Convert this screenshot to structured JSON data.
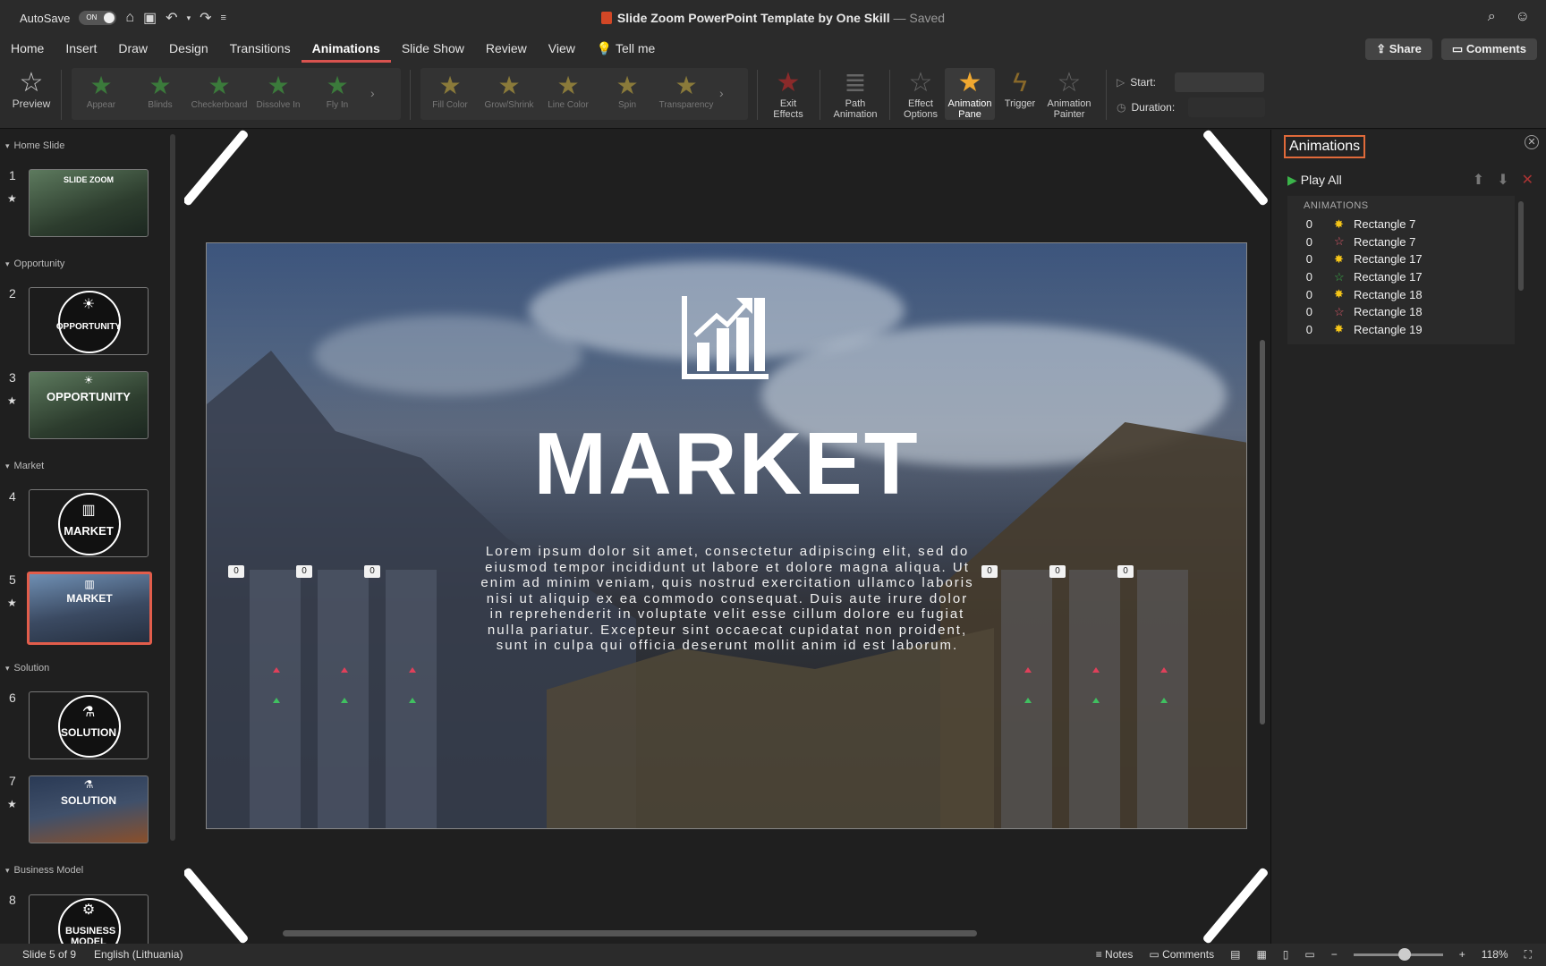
{
  "titlebar": {
    "autosave_label": "AutoSave",
    "autosave_state": "ON",
    "doc_title": "Slide Zoom PowerPoint Template by One Skill",
    "saved_status": "— Saved"
  },
  "menu": {
    "tabs": [
      "Home",
      "Insert",
      "Draw",
      "Design",
      "Transitions",
      "Animations",
      "Slide Show",
      "Review",
      "View"
    ],
    "tell_me": "Tell me",
    "share": "Share",
    "comments": "Comments"
  },
  "ribbon": {
    "preview": "Preview",
    "entrance_effects": [
      "Appear",
      "Blinds",
      "Checkerboard",
      "Dissolve In",
      "Fly In"
    ],
    "emphasis_effects": [
      "Fill Color",
      "Grow/Shrink",
      "Line Color",
      "Spin",
      "Transparency"
    ],
    "exit_effects_l1": "Exit",
    "exit_effects_l2": "Effects",
    "path_animation_l1": "Path",
    "path_animation_l2": "Animation",
    "effect_options_l1": "Effect",
    "effect_options_l2": "Options",
    "animation_pane_l1": "Animation",
    "animation_pane_l2": "Pane",
    "trigger": "Trigger",
    "animation_painter_l1": "Animation",
    "animation_painter_l2": "Painter",
    "start_label": "Start:",
    "duration_label": "Duration:"
  },
  "thumbnails": {
    "sections": [
      "Home Slide",
      "Opportunity",
      "Market",
      "Solution",
      "Business Model"
    ],
    "slides": [
      {
        "num": "1",
        "label": "SLIDE ZOOM"
      },
      {
        "num": "2",
        "label": "OPPORTUNITY"
      },
      {
        "num": "3",
        "label": "OPPORTUNITY"
      },
      {
        "num": "4",
        "label": "MARKET"
      },
      {
        "num": "5",
        "label": "MARKET"
      },
      {
        "num": "6",
        "label": "SOLUTION"
      },
      {
        "num": "7",
        "label": "SOLUTION"
      },
      {
        "num": "8",
        "label": "BUSINESS MODEL"
      }
    ]
  },
  "slide": {
    "title": "MARKET",
    "body": "Lorem ipsum dolor sit amet, consectetur adipiscing elit, sed do eiusmod tempor incididunt ut labore et dolore magna aliqua. Ut enim ad minim veniam, quis nostrud exercitation ullamco laboris nisi ut aliquip ex ea commodo consequat. Duis aute irure dolor in reprehenderit in voluptate velit esse cillum dolore eu fugiat nulla pariatur. Excepteur sint occaecat cupidatat non proident, sunt in culpa qui officia deserunt mollit anim id est laborum.",
    "tags": [
      "0",
      "0",
      "0",
      "0",
      "0",
      "0"
    ]
  },
  "animation_pane": {
    "title": "Animations",
    "play_all": "Play All",
    "list_header": "ANIMATIONS",
    "items": [
      {
        "order": "0",
        "name": "Rectangle 7",
        "effect_color": "#f5c518"
      },
      {
        "order": "0",
        "name": "Rectangle 7",
        "effect_color": "#e05a6a"
      },
      {
        "order": "0",
        "name": "Rectangle 17",
        "effect_color": "#f5c518"
      },
      {
        "order": "0",
        "name": "Rectangle 17",
        "effect_color": "#3bb44a"
      },
      {
        "order": "0",
        "name": "Rectangle 18",
        "effect_color": "#f5c518"
      },
      {
        "order": "0",
        "name": "Rectangle 18",
        "effect_color": "#e05a6a"
      },
      {
        "order": "0",
        "name": "Rectangle 19",
        "effect_color": "#f5c518"
      }
    ]
  },
  "status": {
    "slide_info": "Slide 5 of 9",
    "language": "English (Lithuania)",
    "notes": "Notes",
    "comments": "Comments",
    "zoom": "118%"
  },
  "colors": {
    "accent": "#d9534f",
    "selection": "#e25d4b",
    "pane_title_border": "#e06a3a"
  }
}
